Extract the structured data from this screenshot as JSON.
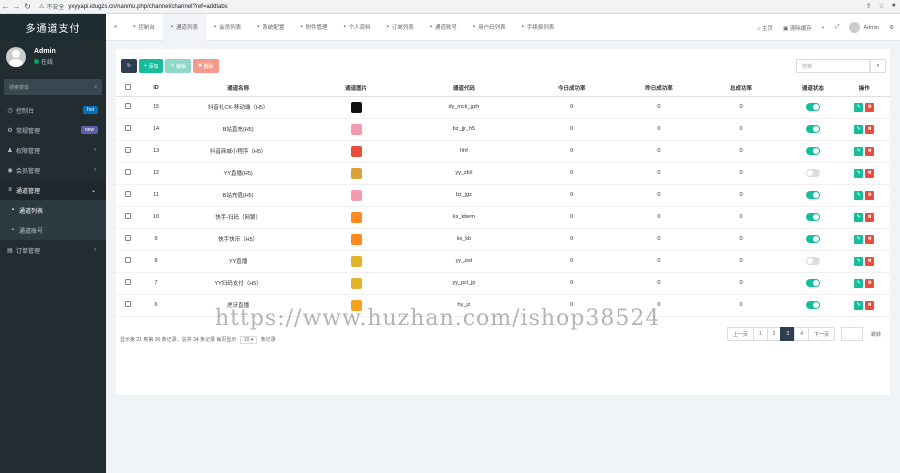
{
  "browser": {
    "security": "不安全",
    "url": "yxyyapi.idugzs.cn/nanmu.php/channel/channel?ref=addtabs"
  },
  "sidebar": {
    "logo": "多通道支付",
    "user_name": "Admin",
    "user_status": "在线",
    "search_placeholder": "搜索菜单",
    "items": [
      {
        "label": "控制台",
        "icon": "dashboard-icon",
        "badge": "hot",
        "badge_color": "#0073b7"
      },
      {
        "label": "常规管理",
        "icon": "cogs-icon",
        "badge": "new",
        "badge_color": "#605ca8"
      },
      {
        "label": "权限管理",
        "icon": "group-icon"
      },
      {
        "label": "会员管理",
        "icon": "user-icon"
      },
      {
        "label": "通道管理",
        "icon": "list-icon"
      },
      {
        "label": "通道列表",
        "icon": "circle-icon"
      },
      {
        "label": "通道账号",
        "icon": "circle-icon"
      },
      {
        "label": "订单管理",
        "icon": "order-icon"
      }
    ]
  },
  "topnav": {
    "tabs": [
      {
        "label": "控制台",
        "icon": "dashboard-icon"
      },
      {
        "label": "通道列表",
        "icon": "list-icon"
      },
      {
        "label": "会员列表",
        "icon": "user-icon"
      },
      {
        "label": "系统配置",
        "icon": "cog-icon"
      },
      {
        "label": "附件管理",
        "icon": "file-icon"
      },
      {
        "label": "个人资料",
        "icon": "user-icon"
      },
      {
        "label": "订单列表",
        "icon": "file-icon"
      },
      {
        "label": "通道账号",
        "icon": "id-icon"
      },
      {
        "label": "用户码列表",
        "icon": "circle-icon"
      },
      {
        "label": "手续费列表",
        "icon": "circle-icon"
      }
    ],
    "home": "主页",
    "clear_cache": "清除缓存",
    "admin": "Admin"
  },
  "toolbar": {
    "add": "添加",
    "edit": "编辑",
    "delete": "删除",
    "search_placeholder": "搜索"
  },
  "table": {
    "headers": [
      "ID",
      "通道名称",
      "通道图片",
      "通道代码",
      "今日成功率",
      "昨日成功率",
      "总成功率",
      "通道状态",
      "操作"
    ],
    "rows": [
      {
        "id": "15",
        "name": "抖音礼CK-移动端（H5）",
        "img_color": "#111111",
        "code": "dy_mck_gzh",
        "today": "0",
        "yesterday": "0",
        "total": "0",
        "status": "on"
      },
      {
        "id": "14",
        "name": "B站直充(H5)",
        "img_color": "#f19ab0",
        "code": "bz_jjr_h5",
        "today": "0",
        "yesterday": "0",
        "total": "0",
        "status": "on"
      },
      {
        "id": "13",
        "name": "抖音商城小程序（H5）",
        "img_color": "#e8503c",
        "code": "hhf",
        "today": "0",
        "yesterday": "0",
        "total": "0",
        "status": "on"
      },
      {
        "id": "12",
        "name": "YY直播(H5)",
        "img_color": "#d9a33c",
        "code": "yy_zb/i",
        "today": "0",
        "yesterday": "0",
        "total": "0",
        "status": "off"
      },
      {
        "id": "11",
        "name": "B站充值(H5)",
        "img_color": "#f19ab0",
        "code": "bz_jgz",
        "today": "0",
        "yesterday": "0",
        "total": "0",
        "status": "on"
      },
      {
        "id": "10",
        "name": "快手-扫码（网银）",
        "img_color": "#ff8a1f",
        "code": "ks_kbem",
        "today": "0",
        "yesterday": "0",
        "total": "0",
        "status": "on"
      },
      {
        "id": "9",
        "name": "快手快币（H5）",
        "img_color": "#ff8a1f",
        "code": "ks_kb",
        "today": "0",
        "yesterday": "0",
        "total": "0",
        "status": "on"
      },
      {
        "id": "8",
        "name": "YY直播",
        "img_color": "#e2b22b",
        "code": "yy_zwl",
        "today": "0",
        "yesterday": "0",
        "total": "0",
        "status": "off"
      },
      {
        "id": "7",
        "name": "YY扫码支付（H5）",
        "img_color": "#e2b22b",
        "code": "yy_pcl_jp",
        "today": "0",
        "yesterday": "0",
        "total": "0",
        "status": "on"
      },
      {
        "id": "6",
        "name": "虎牙直播",
        "img_color": "#f6a21a",
        "code": "hy_jz",
        "today": "0",
        "yesterday": "0",
        "total": "0",
        "status": "on"
      }
    ]
  },
  "footer": {
    "summary": "显示第 21 到第 30 条记录，总共 34 条记录 每页显示",
    "page_size": "10",
    "suffix": "条记录"
  },
  "pager": {
    "prev": "上一页",
    "pages": [
      "1",
      "2",
      "3",
      "4"
    ],
    "active": "3",
    "next": "下一页",
    "go": "跳转"
  },
  "watermark": "https://www.huzhan.com/ishop38524"
}
